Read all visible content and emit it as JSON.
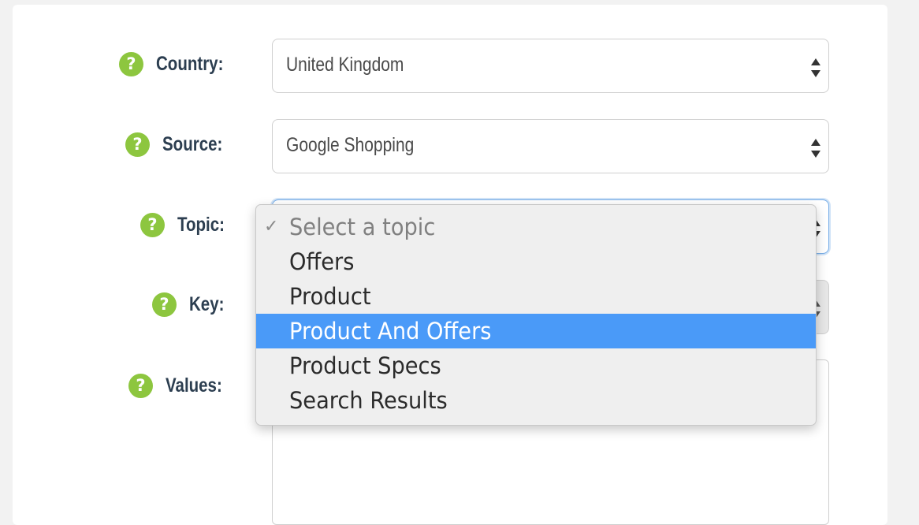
{
  "form": {
    "country": {
      "label": "Country:",
      "value": "United Kingdom"
    },
    "source": {
      "label": "Source:",
      "value": "Google Shopping"
    },
    "topic": {
      "label": "Topic:",
      "value": "Select a topic"
    },
    "key": {
      "label": "Key:",
      "value": ""
    },
    "values": {
      "label": "Values:",
      "value": ""
    }
  },
  "topic_dropdown": {
    "check_glyph": "✓",
    "options": [
      {
        "label": "Select a topic",
        "selected": true,
        "highlighted": false,
        "placeholder": true
      },
      {
        "label": "Offers",
        "selected": false,
        "highlighted": false,
        "placeholder": false
      },
      {
        "label": "Product",
        "selected": false,
        "highlighted": false,
        "placeholder": false
      },
      {
        "label": "Product And Offers",
        "selected": false,
        "highlighted": true,
        "placeholder": false
      },
      {
        "label": "Product Specs",
        "selected": false,
        "highlighted": false,
        "placeholder": false
      },
      {
        "label": "Search Results",
        "selected": false,
        "highlighted": false,
        "placeholder": false
      }
    ]
  },
  "icons": {
    "help": "question-mark-circle-icon",
    "help_glyph": "?",
    "select_arrows": "up-down-arrows-icon"
  },
  "colors": {
    "help_icon": "#8dc63f",
    "label_text": "#2c3e50",
    "highlight": "#4a9af8",
    "focus_border": "#78aee8"
  }
}
